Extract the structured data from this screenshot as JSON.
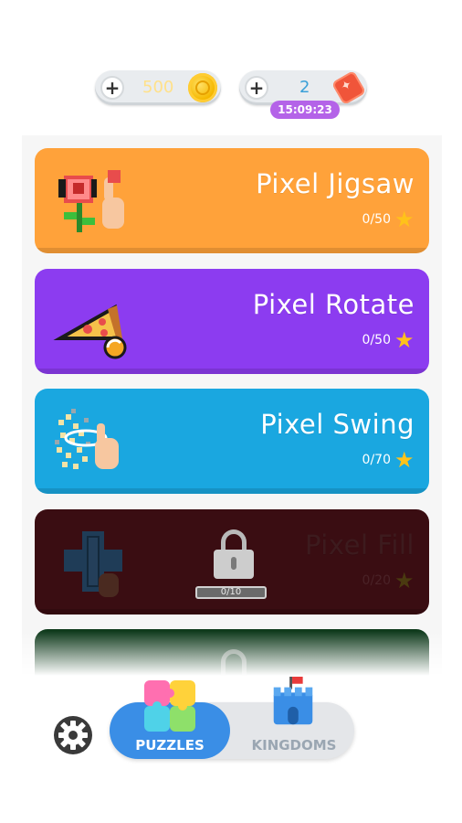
{
  "currency": {
    "coins": {
      "value": "500",
      "icon": "coin-icon"
    },
    "tickets": {
      "value": "2",
      "icon": "ticket-icon",
      "timer": "15:09:23"
    },
    "add_icon": "plus-icon"
  },
  "modes": [
    {
      "title": "Pixel Jigsaw",
      "progress": "0/50",
      "color": "#ffa23a",
      "locked": false,
      "icon": "rose-puzzle-icon"
    },
    {
      "title": "Pixel Rotate",
      "progress": "0/50",
      "color": "#8c3cf0",
      "locked": false,
      "icon": "pizza-rotate-icon"
    },
    {
      "title": "Pixel Swing",
      "progress": "0/70",
      "color": "#1aa7e0",
      "locked": false,
      "icon": "swing-pixels-icon"
    },
    {
      "title": "Pixel Fill",
      "progress": "0/20",
      "color": "#3a0d12",
      "locked": true,
      "unlock_progress": "0/10",
      "icon": "cross-fill-icon"
    },
    {
      "title": "",
      "progress": "",
      "color": "#0f3a1c",
      "locked": true,
      "icon": "locked-mode-icon"
    }
  ],
  "tabs": [
    {
      "label": "PUZZLES",
      "active": true,
      "icon": "puzzle-icon"
    },
    {
      "label": "KINGDOMS",
      "active": false,
      "icon": "castle-icon"
    }
  ],
  "settings": {
    "icon": "gear-icon"
  }
}
